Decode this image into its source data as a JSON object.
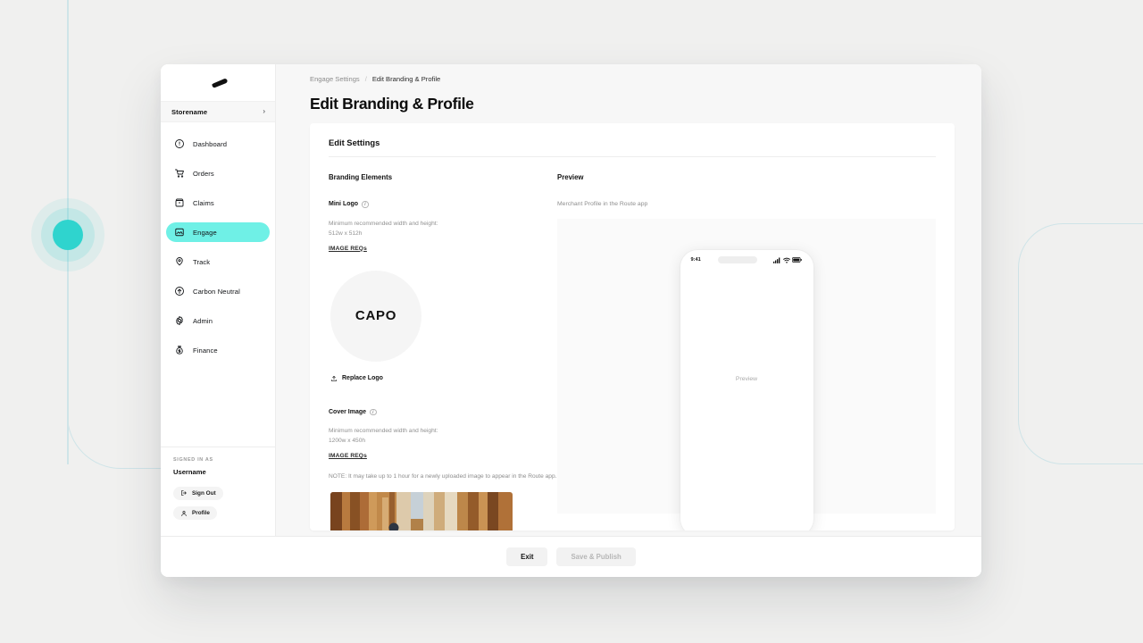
{
  "window": {
    "brand_logo_icon": "route-swoosh-logo"
  },
  "sidebar": {
    "store": {
      "name": "Storename",
      "chevron": "›"
    },
    "items": [
      {
        "label": "Dashboard",
        "icon": "dashboard-gauge-icon",
        "active": false
      },
      {
        "label": "Orders",
        "icon": "shopping-cart-icon",
        "active": false
      },
      {
        "label": "Claims",
        "icon": "claims-box-icon",
        "active": false
      },
      {
        "label": "Engage",
        "icon": "image-engage-icon",
        "active": true
      },
      {
        "label": "Track",
        "icon": "location-pin-icon",
        "active": false
      },
      {
        "label": "Carbon Neutral",
        "icon": "carbon-neutral-icon",
        "active": false
      },
      {
        "label": "Admin",
        "icon": "gear-icon",
        "active": false
      },
      {
        "label": "Finance",
        "icon": "money-bag-icon",
        "active": false
      }
    ],
    "footer": {
      "signed_in_as": "SIGNED IN AS",
      "username": "Username",
      "sign_out": "Sign Out",
      "profile": "Profile"
    }
  },
  "breadcrumb": {
    "parent": "Engage Settings",
    "separator": "/",
    "current": "Edit Branding & Profile"
  },
  "page": {
    "title": "Edit Branding & Profile"
  },
  "card": {
    "header": "Edit Settings"
  },
  "branding": {
    "section_title": "Branding Elements",
    "mini_logo": {
      "label": "Mini Logo",
      "info_icon": "info-circle-icon",
      "help_line1": "Minimum recommended width and height:",
      "help_line2": "512w x 512h",
      "image_reqs_link": "IMAGE REQs",
      "logo_text": "CAPO",
      "replace_label": "Replace Logo",
      "replace_icon": "upload-icon"
    },
    "cover_image": {
      "label": "Cover Image",
      "info_icon": "info-circle-icon",
      "help_line1": "Minimum recommended width and height:",
      "help_line2": "1200w x 450h",
      "image_reqs_link": "IMAGE REQs",
      "note": "NOTE: It may take up to 1 hour for a newly uploaded image to appear in the Route app.",
      "thumbnail_alt": "narrow-street-market-photo"
    }
  },
  "preview": {
    "section_title": "Preview",
    "subtitle": "Merchant Profile in the Route app",
    "phone": {
      "time": "9:41",
      "signal_icon": "cellular-signal-icon",
      "wifi_icon": "wifi-icon",
      "battery_icon": "battery-icon",
      "body_text": "Preview"
    }
  },
  "footer": {
    "exit_label": "Exit",
    "save_label": "Save & Publish",
    "save_disabled": true
  },
  "colors": {
    "accent": "#6ff0e6",
    "accent_dot": "#2fd4ce",
    "deco_line": "#cfe4e8",
    "page_bg": "#f0f0ef",
    "panel_bg": "#f7f7f7"
  }
}
